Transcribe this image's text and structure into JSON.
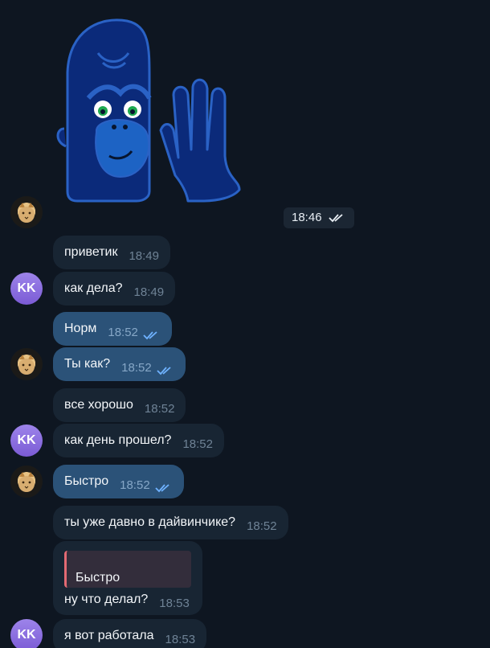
{
  "sticker": {
    "name": "gorilla-wave-sticker",
    "time": "18:46",
    "status": "read"
  },
  "avatars": {
    "me": "cat-photo",
    "other_initials": "KK"
  },
  "messages": [
    {
      "text": "приветик",
      "time": "18:49",
      "direction": "in"
    },
    {
      "text": "как дела?",
      "time": "18:49",
      "direction": "in"
    },
    {
      "text": "Норм",
      "time": "18:52",
      "direction": "out",
      "status": "read"
    },
    {
      "text": "Ты как?",
      "time": "18:52",
      "direction": "out",
      "status": "read"
    },
    {
      "text": "все хорошо",
      "time": "18:52",
      "direction": "in"
    },
    {
      "text": "как день прошел?",
      "time": "18:52",
      "direction": "in"
    },
    {
      "text": "Быстро",
      "time": "18:52",
      "direction": "out",
      "status": "read"
    },
    {
      "text": "ты уже давно в дайвинчике?",
      "time": "18:52",
      "direction": "in"
    },
    {
      "text": "ну что делал?",
      "time": "18:53",
      "direction": "in",
      "reply_to": "Быстро"
    },
    {
      "text": "я вот работала",
      "time": "18:53",
      "direction": "in"
    }
  ],
  "colors": {
    "background": "#0e1621",
    "incoming_bubble": "#182533",
    "outgoing_bubble": "#2b5278",
    "reply_accent": "#e36a73",
    "avatar_accent": "#8f72e3"
  }
}
